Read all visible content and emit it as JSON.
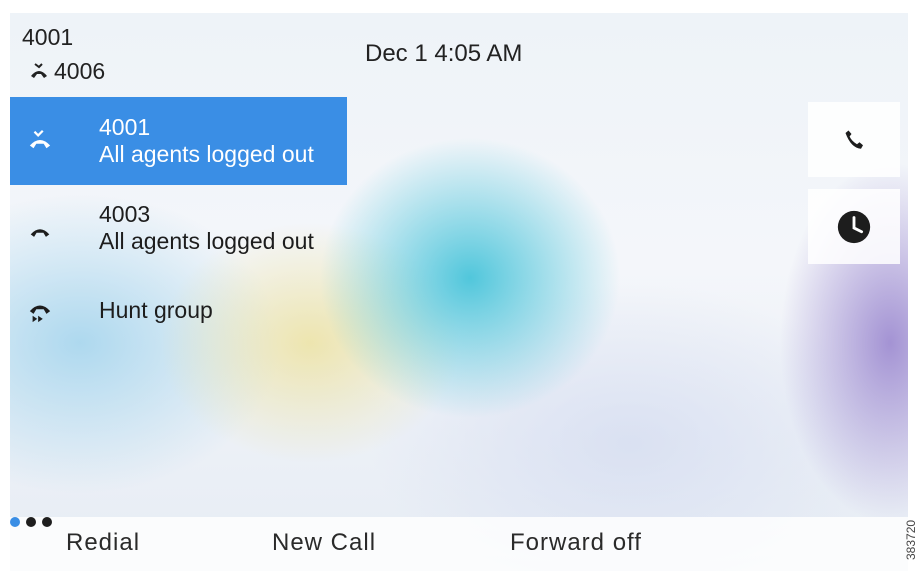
{
  "header": {
    "line_number": "4001",
    "hunt_line": "4006",
    "hunt_icon": "hunt-agent-icon",
    "datetime": "Dec 1 4:05 AM"
  },
  "lines": [
    {
      "number": "4001",
      "status": "All agents logged out",
      "icon": "hunt-agent-logged-out-icon",
      "selected": true
    },
    {
      "number": "4003",
      "status": "All agents logged out",
      "icon": "handset-icon",
      "selected": false
    },
    {
      "label": "Hunt group",
      "icon": "hunt-group-icon",
      "selected": false
    }
  ],
  "side_buttons": [
    {
      "icon": "phone-icon"
    },
    {
      "icon": "recents-clock-icon"
    }
  ],
  "softkeys": {
    "redial": "Redial",
    "new_call": "New Call",
    "forward": "Forward off",
    "more_icon": "more-dots-icon",
    "page_indicator": {
      "current": 1,
      "total": 3
    }
  },
  "watermark": "383720",
  "colors": {
    "selection": "#3a8ee5",
    "text": "#1d1d1d"
  }
}
